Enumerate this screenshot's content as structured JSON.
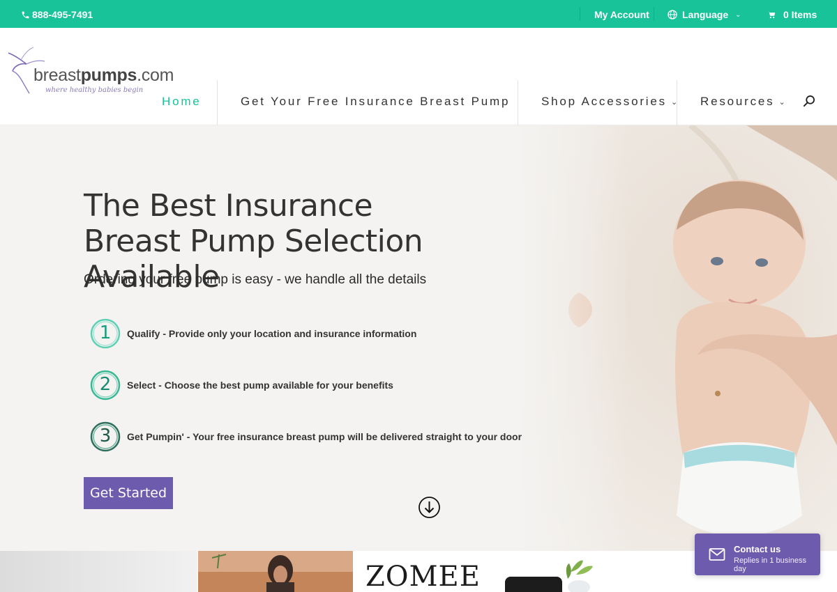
{
  "topbar": {
    "phone": "888-495-7491",
    "my_account": "My Account",
    "language": "Language",
    "cart": "0 Items"
  },
  "logo": {
    "name_part1": "breast",
    "name_part2": "pumps",
    "name_part3": ".com",
    "tagline": "where healthy babies begin"
  },
  "nav": {
    "items": [
      {
        "label": "Home",
        "active": true
      },
      {
        "label": "Get Your Free Insurance Breast Pump",
        "active": false
      },
      {
        "label": "Shop Accessories",
        "active": false,
        "has_dropdown": true
      },
      {
        "label": "Resources",
        "active": false,
        "has_dropdown": true
      }
    ],
    "search_icon": "search-icon"
  },
  "hero": {
    "title": "The Best Insurance Breast Pump Selection Available",
    "subtitle": "Ordering your free pump is easy - we handle all the details",
    "steps": [
      {
        "number": "1",
        "text": "Qualify - Provide only your location and insurance information"
      },
      {
        "number": "2",
        "text": "Select - Choose the best pump available for your benefits"
      },
      {
        "number": "3",
        "text": "Get Pumpin' - Your free insurance breast pump will be delivered straight to your door"
      }
    ],
    "cta_label": "Get Started"
  },
  "strip": {
    "brand": "ZOMEE"
  },
  "contact": {
    "title": "Contact us",
    "subtitle": "Replies in 1 business day"
  },
  "colors": {
    "accent": "#18c39a",
    "purple": "#6d5bae",
    "text": "#333333"
  }
}
